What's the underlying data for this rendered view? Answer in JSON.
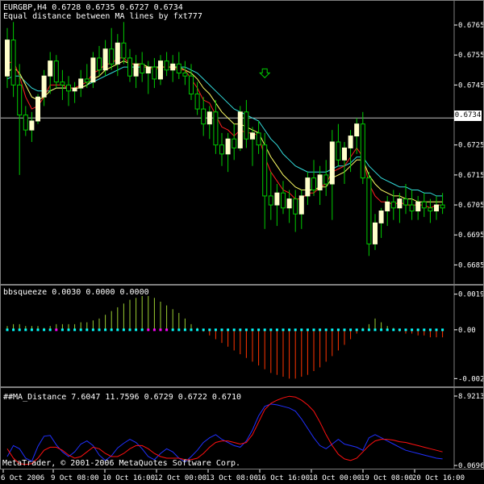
{
  "main": {
    "symbol_line": "EURGBP,H4  0.6728 0.6735 0.6727 0.6734",
    "indicator_title": "Equal distance between MA lines by fxt777",
    "y_ticks": [
      "0.6765",
      "0.6755",
      "0.6745",
      "0.6734",
      "0.6725",
      "0.6715",
      "0.6705",
      "0.6695",
      "0.6685"
    ],
    "current_price": "0.6734"
  },
  "bbsqueeze": {
    "title": "bbsqueeze 0.0030 0.0000 0.0000",
    "y_ticks": [
      "0.0019",
      "0.00",
      "-0.0026"
    ]
  },
  "ma_distance": {
    "title": "##MA_Distance 7.6047 11.7596 0.6729 0.6722 0.6710",
    "y_ticks": [
      "8.9213",
      "0.0696"
    ]
  },
  "copyright": "MetaTrader, © 2001-2006 MetaQuotes Software Corp.",
  "time_axis": [
    "6 Oct 2006",
    "9 Oct 08:00",
    "10 Oct 16:00",
    "12 Oct 00:00",
    "13 Oct 08:00",
    "16 Oct 16:00",
    "18 Oct 00:00",
    "19 Oct 08:00",
    "20 Oct 16:00"
  ],
  "colors": {
    "bull": "#ffffcc",
    "wick": "#00cc00",
    "ma_yellow": "#ffff66",
    "ma_red": "#ff2020",
    "ma_cyan": "#33dddd",
    "pos_hist": "#9acd32",
    "neg_hist": "#ff3300",
    "dots_cyan": "#00ffff",
    "dots_magenta": "#ff00ff",
    "blue_line": "#2030ff",
    "red_line": "#ff1010"
  },
  "chart_data": [
    {
      "type": "candlestick",
      "title": "EURGBP,H4",
      "ylim": [
        0.668,
        0.6772
      ],
      "candles": [
        [
          0.6748,
          0.6764,
          0.6744,
          0.676
        ],
        [
          0.676,
          0.6766,
          0.6741,
          0.6745
        ],
        [
          0.6745,
          0.6752,
          0.6715,
          0.6735
        ],
        [
          0.6735,
          0.6738,
          0.6728,
          0.673
        ],
        [
          0.673,
          0.6736,
          0.6726,
          0.6733
        ],
        [
          0.6733,
          0.6742,
          0.6732,
          0.6741
        ],
        [
          0.6741,
          0.675,
          0.6738,
          0.6748
        ],
        [
          0.6748,
          0.6756,
          0.6742,
          0.6753
        ],
        [
          0.6753,
          0.6755,
          0.6744,
          0.6746
        ],
        [
          0.6746,
          0.675,
          0.674,
          0.6745
        ],
        [
          0.6745,
          0.6748,
          0.6738,
          0.6743
        ],
        [
          0.6743,
          0.6746,
          0.6739,
          0.6744
        ],
        [
          0.6744,
          0.675,
          0.6741,
          0.6747
        ],
        [
          0.6747,
          0.6752,
          0.6744,
          0.6746
        ],
        [
          0.6746,
          0.6756,
          0.6744,
          0.6754
        ],
        [
          0.6754,
          0.6758,
          0.6748,
          0.675
        ],
        [
          0.675,
          0.676,
          0.6748,
          0.6757
        ],
        [
          0.6757,
          0.6764,
          0.675,
          0.6752
        ],
        [
          0.6752,
          0.6762,
          0.6748,
          0.6759
        ],
        [
          0.6759,
          0.6766,
          0.6752,
          0.6754
        ],
        [
          0.6754,
          0.6757,
          0.6746,
          0.6748
        ],
        [
          0.6748,
          0.6755,
          0.6744,
          0.6752
        ],
        [
          0.6752,
          0.6756,
          0.6746,
          0.6749
        ],
        [
          0.6749,
          0.6753,
          0.6742,
          0.6751
        ],
        [
          0.6751,
          0.6754,
          0.6744,
          0.6747
        ],
        [
          0.6747,
          0.6755,
          0.6745,
          0.6753
        ],
        [
          0.6753,
          0.6756,
          0.6748,
          0.675
        ],
        [
          0.675,
          0.6755,
          0.6746,
          0.6752
        ],
        [
          0.6752,
          0.6756,
          0.6747,
          0.6749
        ],
        [
          0.6749,
          0.6753,
          0.6745,
          0.6748
        ],
        [
          0.6748,
          0.6752,
          0.674,
          0.6742
        ],
        [
          0.6742,
          0.6746,
          0.6735,
          0.6737
        ],
        [
          0.6737,
          0.6741,
          0.6728,
          0.6732
        ],
        [
          0.6732,
          0.6738,
          0.6727,
          0.6736
        ],
        [
          0.6736,
          0.674,
          0.6722,
          0.6725
        ],
        [
          0.6725,
          0.6729,
          0.6718,
          0.6722
        ],
        [
          0.6722,
          0.6729,
          0.6716,
          0.6727
        ],
        [
          0.6727,
          0.6732,
          0.672,
          0.6724
        ],
        [
          0.6724,
          0.6738,
          0.6723,
          0.6736
        ],
        [
          0.6736,
          0.674,
          0.6724,
          0.6727
        ],
        [
          0.6727,
          0.6731,
          0.6718,
          0.6729
        ],
        [
          0.6729,
          0.6733,
          0.6722,
          0.6725
        ],
        [
          0.6725,
          0.6729,
          0.6697,
          0.6708
        ],
        [
          0.6708,
          0.6716,
          0.67,
          0.6705
        ],
        [
          0.6705,
          0.6712,
          0.6698,
          0.6709
        ],
        [
          0.6709,
          0.6713,
          0.6702,
          0.6704
        ],
        [
          0.6704,
          0.671,
          0.6699,
          0.6707
        ],
        [
          0.6707,
          0.671,
          0.6696,
          0.6702
        ],
        [
          0.6702,
          0.671,
          0.6697,
          0.6708
        ],
        [
          0.6708,
          0.6716,
          0.6705,
          0.6714
        ],
        [
          0.6714,
          0.672,
          0.6708,
          0.671
        ],
        [
          0.671,
          0.6718,
          0.6705,
          0.6715
        ],
        [
          0.6715,
          0.672,
          0.6708,
          0.6712
        ],
        [
          0.6712,
          0.673,
          0.67,
          0.6726
        ],
        [
          0.6726,
          0.6732,
          0.6718,
          0.672
        ],
        [
          0.672,
          0.6726,
          0.6712,
          0.6724
        ],
        [
          0.6724,
          0.673,
          0.6716,
          0.6728
        ],
        [
          0.6728,
          0.6734,
          0.6722,
          0.6732
        ],
        [
          0.6732,
          0.6736,
          0.6712,
          0.6714
        ],
        [
          0.6714,
          0.6716,
          0.6688,
          0.6692
        ],
        [
          0.6692,
          0.6702,
          0.669,
          0.6699
        ],
        [
          0.6699,
          0.6704,
          0.6694,
          0.6703
        ],
        [
          0.6703,
          0.6708,
          0.6698,
          0.6706
        ],
        [
          0.6706,
          0.671,
          0.67,
          0.6704
        ],
        [
          0.6704,
          0.6709,
          0.6699,
          0.6707
        ],
        [
          0.6707,
          0.6712,
          0.6702,
          0.6705
        ],
        [
          0.6705,
          0.671,
          0.67,
          0.6703
        ],
        [
          0.6703,
          0.6708,
          0.67,
          0.6706
        ],
        [
          0.6706,
          0.6709,
          0.6701,
          0.6704
        ],
        [
          0.6704,
          0.6707,
          0.6699,
          0.6703
        ],
        [
          0.6703,
          0.6708,
          0.67,
          0.6705
        ],
        [
          0.6705,
          0.6709,
          0.6702,
          0.6704
        ]
      ],
      "ma_fast": [
        0.6752,
        0.6753,
        0.6748,
        0.6741,
        0.6737,
        0.6738,
        0.6741,
        0.6745,
        0.6745,
        0.6745,
        0.6744,
        0.6744,
        0.6745,
        0.6746,
        0.6749,
        0.675,
        0.6752,
        0.6752,
        0.6754,
        0.6754,
        0.6752,
        0.6752,
        0.6751,
        0.6751,
        0.675,
        0.6751,
        0.6751,
        0.6751,
        0.675,
        0.675,
        0.6747,
        0.6744,
        0.674,
        0.6739,
        0.6735,
        0.6731,
        0.673,
        0.6728,
        0.673,
        0.6729,
        0.6729,
        0.6728,
        0.6721,
        0.6716,
        0.6713,
        0.671,
        0.6709,
        0.6707,
        0.6707,
        0.6709,
        0.6709,
        0.6711,
        0.6712,
        0.6716,
        0.6717,
        0.6718,
        0.6721,
        0.6724,
        0.6721,
        0.6712,
        0.6708,
        0.6706,
        0.6706,
        0.6705,
        0.6706,
        0.6705,
        0.6705,
        0.6705,
        0.6705,
        0.6704,
        0.6705,
        0.6705
      ],
      "ma_mid": [
        0.6749,
        0.6751,
        0.6749,
        0.6745,
        0.6741,
        0.674,
        0.6741,
        0.6743,
        0.6744,
        0.6744,
        0.6744,
        0.6744,
        0.6744,
        0.6745,
        0.6747,
        0.6748,
        0.675,
        0.6751,
        0.6752,
        0.6753,
        0.6752,
        0.6752,
        0.6752,
        0.6751,
        0.6751,
        0.6751,
        0.6751,
        0.6751,
        0.6751,
        0.675,
        0.6749,
        0.6747,
        0.6744,
        0.6742,
        0.6739,
        0.6736,
        0.6734,
        0.6732,
        0.6732,
        0.6731,
        0.673,
        0.6729,
        0.6725,
        0.6721,
        0.6718,
        0.6715,
        0.6713,
        0.6711,
        0.671,
        0.671,
        0.671,
        0.6711,
        0.6711,
        0.6714,
        0.6715,
        0.6716,
        0.6718,
        0.672,
        0.672,
        0.6715,
        0.6712,
        0.671,
        0.6709,
        0.6708,
        0.6708,
        0.6707,
        0.6707,
        0.6706,
        0.6706,
        0.6706,
        0.6706,
        0.6706
      ],
      "ma_slow": [
        0.6747,
        0.6748,
        0.6748,
        0.6746,
        0.6744,
        0.6743,
        0.6743,
        0.6743,
        0.6744,
        0.6744,
        0.6744,
        0.6744,
        0.6744,
        0.6745,
        0.6746,
        0.6747,
        0.6748,
        0.6749,
        0.675,
        0.6751,
        0.6751,
        0.6751,
        0.6751,
        0.6751,
        0.6751,
        0.6751,
        0.6751,
        0.6751,
        0.6751,
        0.6751,
        0.675,
        0.6749,
        0.6747,
        0.6745,
        0.6743,
        0.6741,
        0.6739,
        0.6737,
        0.6736,
        0.6735,
        0.6734,
        0.6733,
        0.673,
        0.6727,
        0.6725,
        0.6722,
        0.672,
        0.6718,
        0.6717,
        0.6716,
        0.6716,
        0.6716,
        0.6716,
        0.6717,
        0.6718,
        0.6718,
        0.6719,
        0.6721,
        0.6721,
        0.6718,
        0.6716,
        0.6714,
        0.6713,
        0.6712,
        0.6711,
        0.6711,
        0.671,
        0.671,
        0.6709,
        0.6709,
        0.6708,
        0.6708
      ]
    },
    {
      "type": "bar",
      "title": "bbsqueeze",
      "ylim": [
        -0.0028,
        0.0021
      ],
      "values": [
        0.0002,
        0.0003,
        0.0003,
        0.0002,
        0.0002,
        0.0002,
        0.0001,
        0.0002,
        0.0003,
        0.0003,
        0.0003,
        0.0003,
        0.0004,
        0.0004,
        0.0005,
        0.0006,
        0.0008,
        0.001,
        0.0012,
        0.0014,
        0.0016,
        0.0017,
        0.0018,
        0.0018,
        0.0017,
        0.0015,
        0.0013,
        0.0011,
        0.0009,
        0.0006,
        0.0003,
        0.0001,
        -0.0001,
        -0.0003,
        -0.0005,
        -0.0007,
        -0.0009,
        -0.0011,
        -0.0013,
        -0.0015,
        -0.0017,
        -0.0019,
        -0.0021,
        -0.0023,
        -0.0024,
        -0.0025,
        -0.0026,
        -0.0026,
        -0.0025,
        -0.0024,
        -0.0022,
        -0.002,
        -0.0017,
        -0.0014,
        -0.0011,
        -0.0008,
        -0.0005,
        -0.0002,
        0.0001,
        0.0003,
        0.0006,
        0.0004,
        0.0002,
        0.0001,
        -0.0001,
        -0.0002,
        -0.0002,
        -0.0003,
        -0.0003,
        -0.0004,
        -0.0004,
        -0.0004
      ],
      "dots": [
        "c",
        "c",
        "c",
        "c",
        "c",
        "c",
        "c",
        "c",
        "m",
        "c",
        "c",
        "c",
        "c",
        "c",
        "c",
        "c",
        "c",
        "c",
        "c",
        "c",
        "c",
        "c",
        "c",
        "m",
        "m",
        "m",
        "m",
        "c",
        "c",
        "c",
        "c",
        "c",
        "c",
        "c",
        "c",
        "c",
        "c",
        "c",
        "c",
        "c",
        "c",
        "c",
        "c",
        "c",
        "c",
        "c",
        "c",
        "c",
        "c",
        "c",
        "c",
        "c",
        "c",
        "c",
        "c",
        "c",
        "c",
        "c",
        "c",
        "c",
        "c",
        "c",
        "c",
        "c",
        "c",
        "c",
        "c",
        "c",
        "c",
        "c",
        "c",
        "c"
      ]
    },
    {
      "type": "line",
      "title": "##MA_Distance",
      "ylim": [
        0.0696,
        8.9213
      ],
      "series": [
        {
          "name": "",
          "color_key": "blue_line",
          "values": [
            1.2,
            2.6,
            2.2,
            1.0,
            0.6,
            2.5,
            3.8,
            3.9,
            2.7,
            1.8,
            1.2,
            1.8,
            2.8,
            3.2,
            2.6,
            1.4,
            0.7,
            1.3,
            2.3,
            2.9,
            3.4,
            3.0,
            2.2,
            1.2,
            0.8,
            1.6,
            2.2,
            1.8,
            1.0,
            0.5,
            1.2,
            2.0,
            3.0,
            3.6,
            4.0,
            3.4,
            3.0,
            2.6,
            2.4,
            3.2,
            4.6,
            6.4,
            7.6,
            7.9,
            7.8,
            7.6,
            7.4,
            7.0,
            6.0,
            4.8,
            3.6,
            2.6,
            2.2,
            2.8,
            3.4,
            2.8,
            2.6,
            2.4,
            2.0,
            3.6,
            4.0,
            3.6,
            3.2,
            2.8,
            2.4,
            2.0,
            1.8,
            1.6,
            1.4,
            1.2,
            1.0,
            0.9
          ]
        },
        {
          "name": "",
          "color_key": "red_line",
          "values": [
            2.2,
            1.0,
            0.3,
            0.2,
            0.3,
            1.0,
            2.0,
            2.4,
            2.4,
            2.0,
            1.4,
            1.0,
            1.2,
            1.8,
            2.4,
            2.2,
            1.6,
            1.2,
            1.2,
            1.6,
            2.2,
            2.6,
            2.6,
            2.2,
            1.6,
            1.2,
            1.0,
            1.0,
            1.0,
            0.8,
            0.8,
            1.0,
            1.6,
            2.4,
            3.0,
            3.2,
            3.2,
            3.0,
            2.8,
            3.0,
            4.0,
            5.6,
            7.2,
            8.0,
            8.4,
            8.7,
            8.9,
            8.8,
            8.4,
            7.8,
            7.0,
            5.6,
            4.0,
            2.6,
            1.5,
            0.9,
            0.7,
            1.0,
            1.8,
            2.6,
            3.2,
            3.4,
            3.4,
            3.3,
            3.1,
            3.0,
            2.8,
            2.6,
            2.4,
            2.2,
            2.0,
            1.8
          ]
        }
      ]
    }
  ]
}
